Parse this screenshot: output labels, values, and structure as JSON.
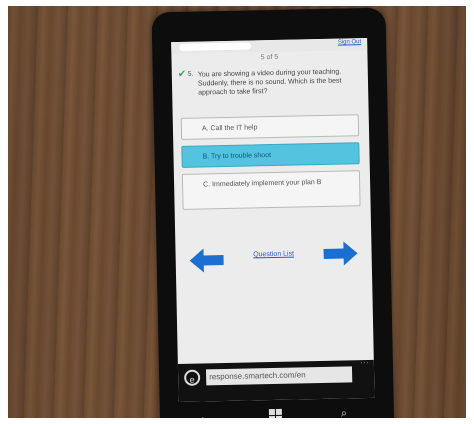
{
  "header": {
    "link": "Sign Out",
    "counter": "5 of 5"
  },
  "question": {
    "number": "5.",
    "text": "You are showing a video during your teaching. Suddenly, there is no sound. Which is the best approach to take first?"
  },
  "options": [
    {
      "label": "A. Call the IT help",
      "selected": false
    },
    {
      "label": "B. Try to trouble shoot",
      "selected": true
    },
    {
      "label": "C. Immediately implement your plan B",
      "selected": false
    }
  ],
  "navigation": {
    "question_list_label": "Question List",
    "arrow_color": "#1a6fd1"
  },
  "browser": {
    "url": "response.smartech.com/en",
    "menu_dots": "..."
  },
  "colors": {
    "selected_option": "#52c4df",
    "check": "#3aa24a",
    "link": "#2a5cc9"
  }
}
